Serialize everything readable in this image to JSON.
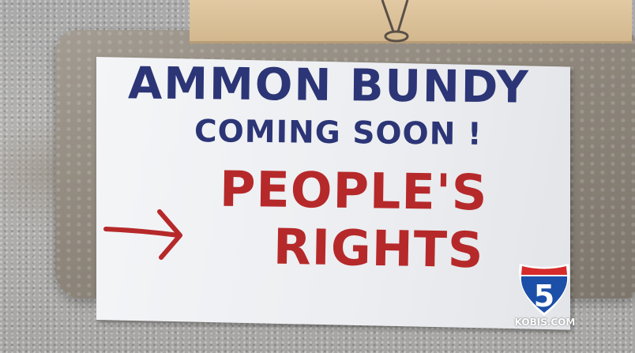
{
  "sign": {
    "line1": "AMMON BUNDY",
    "line2": "COMING SOON !",
    "line3": "PEOPLE'S",
    "line4": "RIGHTS",
    "blue_paint": "#2c3576",
    "red_paint": "#b6292a"
  },
  "watermark": {
    "channel_number": "5",
    "site": "KOBIS.COM",
    "shield_red": "#d62b2b",
    "shield_blue": "#1c4fa8"
  },
  "icons": [
    "arrow-right-icon",
    "interstate-shield-icon"
  ]
}
